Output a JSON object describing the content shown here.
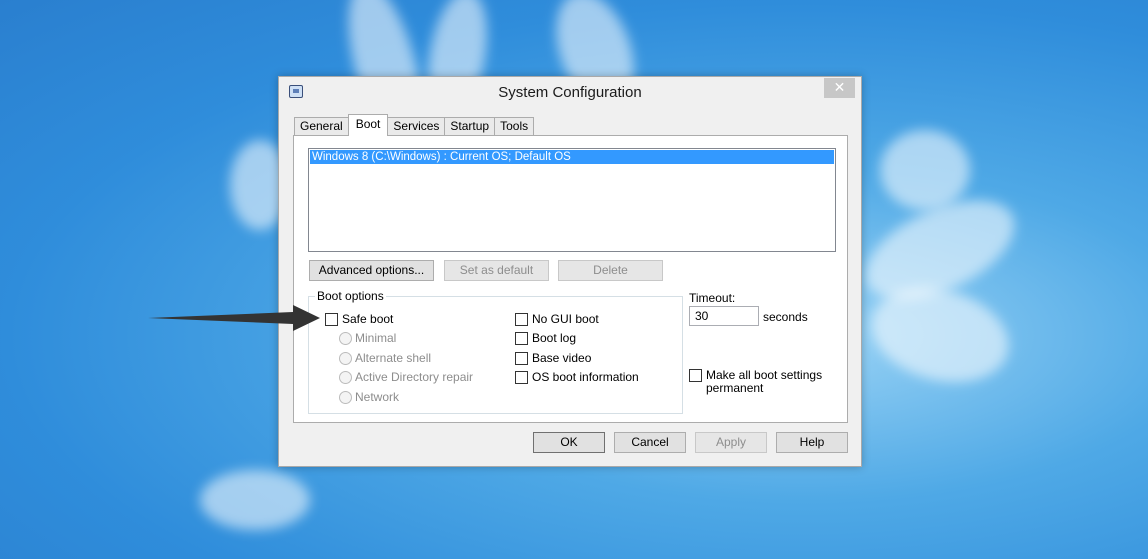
{
  "window": {
    "title": "System Configuration",
    "close_glyph": "✕",
    "icon": "msconfig-icon"
  },
  "tabs": [
    {
      "label": "General",
      "active": false
    },
    {
      "label": "Boot",
      "active": true
    },
    {
      "label": "Services",
      "active": false
    },
    {
      "label": "Startup",
      "active": false
    },
    {
      "label": "Tools",
      "active": false
    }
  ],
  "os_list": {
    "items": [
      "Windows 8 (C:\\Windows) : Current OS; Default OS"
    ],
    "selected": 0
  },
  "list_buttons": {
    "advanced": "Advanced options...",
    "set_default": "Set as default",
    "delete": "Delete"
  },
  "boot_options": {
    "label": "Boot options",
    "safe_boot": "Safe boot",
    "minimal": "Minimal",
    "alternate_shell": "Alternate shell",
    "ad_repair": "Active Directory repair",
    "network": "Network",
    "no_gui_boot": "No GUI boot",
    "boot_log": "Boot log",
    "base_video": "Base video",
    "os_boot_info": "OS boot information"
  },
  "timeout": {
    "label": "Timeout:",
    "value": "30",
    "unit": "seconds"
  },
  "permanent": {
    "label": "Make all boot settings permanent"
  },
  "footer": {
    "ok": "OK",
    "cancel": "Cancel",
    "apply": "Apply",
    "help": "Help"
  },
  "colors": {
    "selection": "#3399ff",
    "desktop": "#2f8ddb",
    "dialog_bg": "#f0f0f0",
    "arrow": "#333333"
  }
}
